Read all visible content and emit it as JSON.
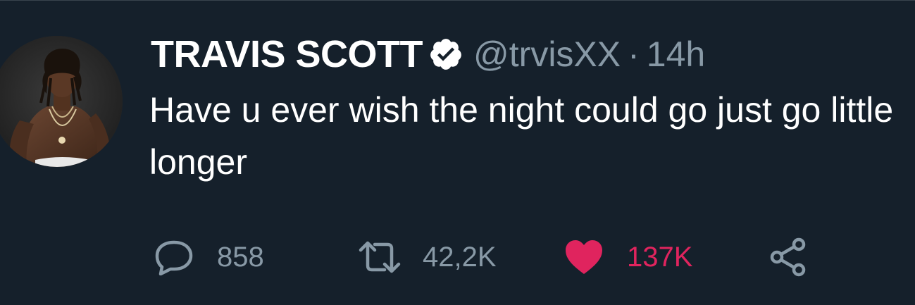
{
  "tweet": {
    "author_name": "TRAVIS SCOTT",
    "handle": "@trvisXX",
    "separator": "·",
    "timestamp": "14h",
    "text": "Have u ever wish the night could go just go little longer"
  },
  "actions": {
    "reply_count": "858",
    "retweet_count": "42,2K",
    "like_count": "137K",
    "like_active": true
  },
  "icons": {
    "reply": "reply-icon",
    "retweet": "retweet-icon",
    "like": "heart-icon",
    "share": "share-icon",
    "verified": "verified-badge-icon"
  },
  "colors": {
    "background": "#15202b",
    "primary_text": "#ffffff",
    "secondary_text": "#8899a6",
    "like": "#e0245e"
  }
}
